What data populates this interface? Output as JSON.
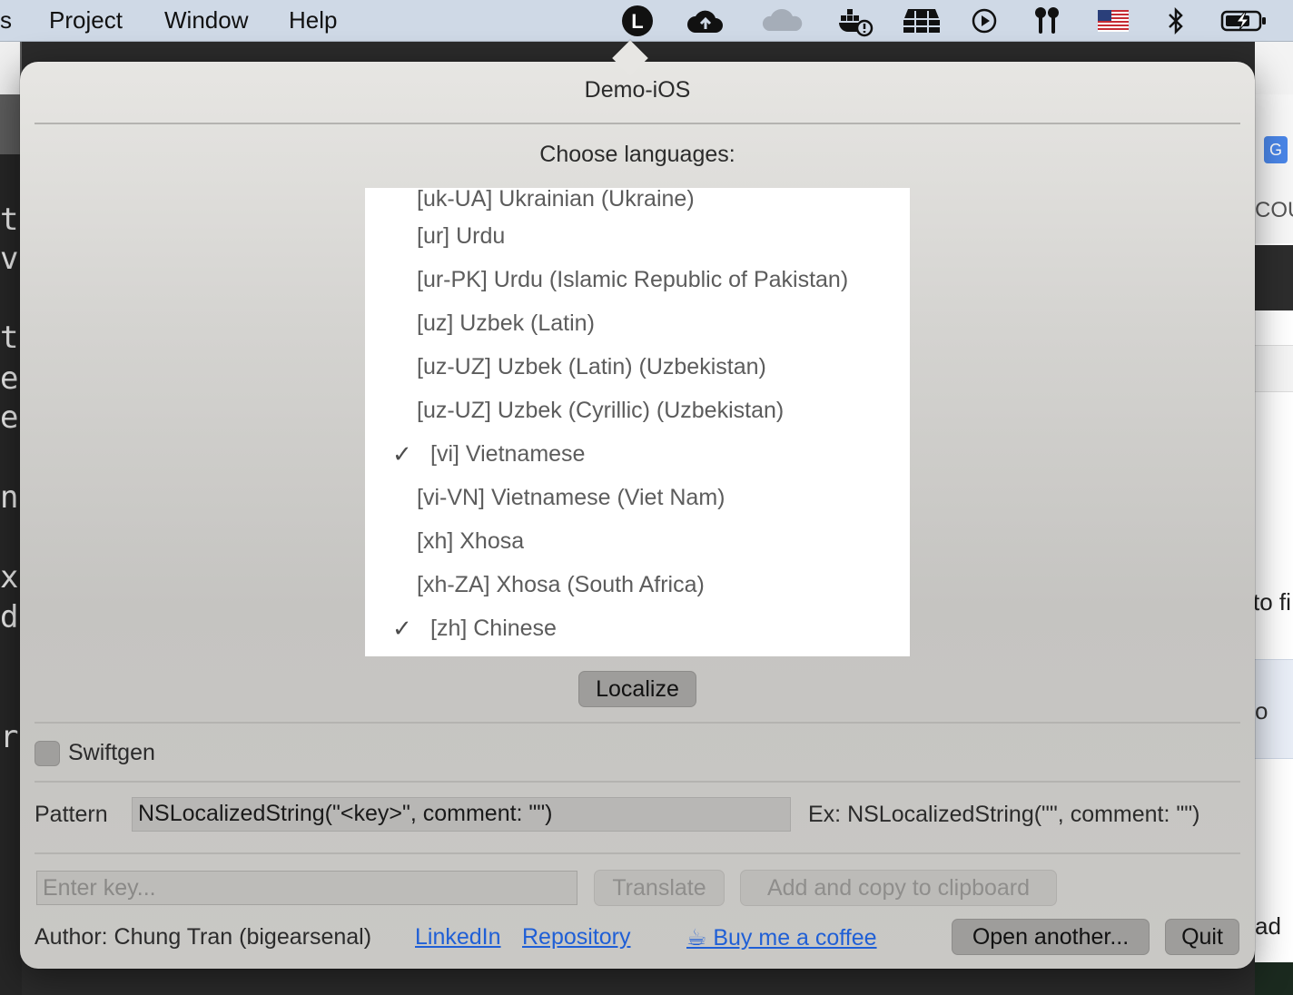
{
  "menubar": {
    "items": [
      "s",
      "Project",
      "Window",
      "Help"
    ],
    "icons": [
      "localizer-app-icon",
      "cloud-upload-icon",
      "cloud-icon",
      "docker-icon",
      "stack-icon",
      "play-circle-icon",
      "airpods-icon",
      "us-flag-icon",
      "bluetooth-icon",
      "battery-charging-icon"
    ],
    "localizer_letter": "L"
  },
  "background": {
    "left_glyphs": [
      "t",
      "vi",
      "te",
      "er",
      "es",
      "n",
      "xa",
      "de",
      "r"
    ],
    "right_glyphs": [
      "COU",
      "to fi",
      "o",
      "ad"
    ]
  },
  "popover": {
    "title": "Demo-iOS",
    "choose_label": "Choose languages:",
    "languages": [
      {
        "label": "[uk-UA] Ukrainian (Ukraine)",
        "checked": false
      },
      {
        "label": "[ur] Urdu",
        "checked": false
      },
      {
        "label": "[ur-PK] Urdu (Islamic Republic of Pakistan)",
        "checked": false
      },
      {
        "label": "[uz] Uzbek (Latin)",
        "checked": false
      },
      {
        "label": "[uz-UZ] Uzbek (Latin) (Uzbekistan)",
        "checked": false
      },
      {
        "label": "[uz-UZ] Uzbek (Cyrillic) (Uzbekistan)",
        "checked": false
      },
      {
        "label": "[vi] Vietnamese",
        "checked": true
      },
      {
        "label": "[vi-VN] Vietnamese (Viet Nam)",
        "checked": false
      },
      {
        "label": "[xh] Xhosa",
        "checked": false
      },
      {
        "label": "[xh-ZA] Xhosa (South Africa)",
        "checked": false
      },
      {
        "label": "[zh] Chinese",
        "checked": true
      }
    ],
    "check_mark": "✓",
    "localize_label": "Localize",
    "swiftgen_label": "Swiftgen",
    "swiftgen_checked": false,
    "pattern_label": "Pattern",
    "pattern_value": "NSLocalizedString(\"<key>\", comment: \"\")",
    "pattern_example": "Ex: NSLocalizedString(\"\", comment: \"\")",
    "key_placeholder": "Enter key...",
    "key_value": "",
    "translate_label": "Translate",
    "add_copy_label": "Add and copy to clipboard",
    "author_text": "Author: Chung Tran (bigearsenal)",
    "linkedin_label": "LinkedIn",
    "repository_label": "Repository",
    "coffee_label": "☕ Buy me a coffee",
    "open_another_label": "Open another...",
    "quit_label": "Quit"
  },
  "colors": {
    "menubar_bg": "#cfd9e6",
    "link": "#1f5fd6",
    "button_bg": "#9e9d9b",
    "list_bg": "#ffffff"
  }
}
